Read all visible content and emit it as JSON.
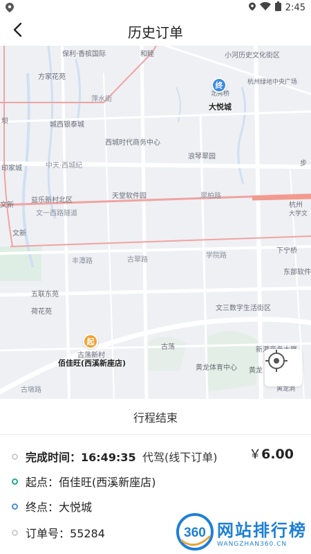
{
  "status_bar": {
    "time": "2:45"
  },
  "header": {
    "title": "历史订单"
  },
  "map": {
    "labels": [
      {
        "text": "保利·香槟国际"
      },
      {
        "text": "和睦"
      },
      {
        "text": "小河历史文化街区"
      },
      {
        "text": "方家花苑"
      },
      {
        "text": "北秀桥"
      },
      {
        "text": "杭州绿地中央广场"
      },
      {
        "text": "萍水街"
      },
      {
        "text": "坝"
      },
      {
        "text": "城西银泰城"
      },
      {
        "text": "西城时代商务中心"
      },
      {
        "text": "浪琴翠园"
      },
      {
        "text": "印家城"
      },
      {
        "text": "中天·西城纪"
      },
      {
        "text": "步"
      },
      {
        "text": "益乐新村北区"
      },
      {
        "text": "天堂软件园"
      },
      {
        "text": "翠柏路"
      },
      {
        "text": "文新"
      },
      {
        "text": "文一西路隧道"
      },
      {
        "text": "杭州"
      },
      {
        "text": "大学文"
      },
      {
        "text": "文新"
      },
      {
        "text": "丰潭路"
      },
      {
        "text": "古翠路"
      },
      {
        "text": "学院路"
      },
      {
        "text": "下宁桥"
      },
      {
        "text": "东部软件"
      },
      {
        "text": "五联东苑"
      },
      {
        "text": "文三数字生活街区"
      },
      {
        "text": "荷花苑"
      },
      {
        "text": "古荡"
      },
      {
        "text": "新港商务大厦"
      },
      {
        "text": "古荡新村"
      },
      {
        "text": "黄龙体育中心"
      },
      {
        "text": "黄龙"
      },
      {
        "text": "古墩路"
      },
      {
        "text": "黄龙洞"
      }
    ],
    "end_pin": {
      "glyph": "终",
      "label": "大悦城"
    },
    "start_pin": {
      "glyph": "起",
      "label": "佰佳旺(西溪新座店)"
    },
    "locate_icon": "crosshair-icon"
  },
  "trip": {
    "status": "行程结束"
  },
  "order": {
    "finish_label": "完成时间：",
    "finish_time": "16:49:35",
    "order_type": "代驾(线下订单)",
    "currency": "￥",
    "amount": "6.00",
    "start_label": "起点：",
    "start_value": "佰佳旺(西溪新座店)",
    "end_label": "终点：",
    "end_value": "大悦城",
    "order_no_label": "订单号：",
    "order_no": "55284"
  },
  "watermark": {
    "badge": "360",
    "cn": "网站排行榜",
    "en": "WANGZHAN360.CN"
  },
  "colors": {
    "green_dot": "#1aaa8e",
    "blue_dot": "#4b89e6",
    "end_pin": "#3b8be4",
    "start_pin": "#f0a234",
    "route_pink": "#f0a3a0",
    "watermark_blue": "#1e7fd6"
  }
}
